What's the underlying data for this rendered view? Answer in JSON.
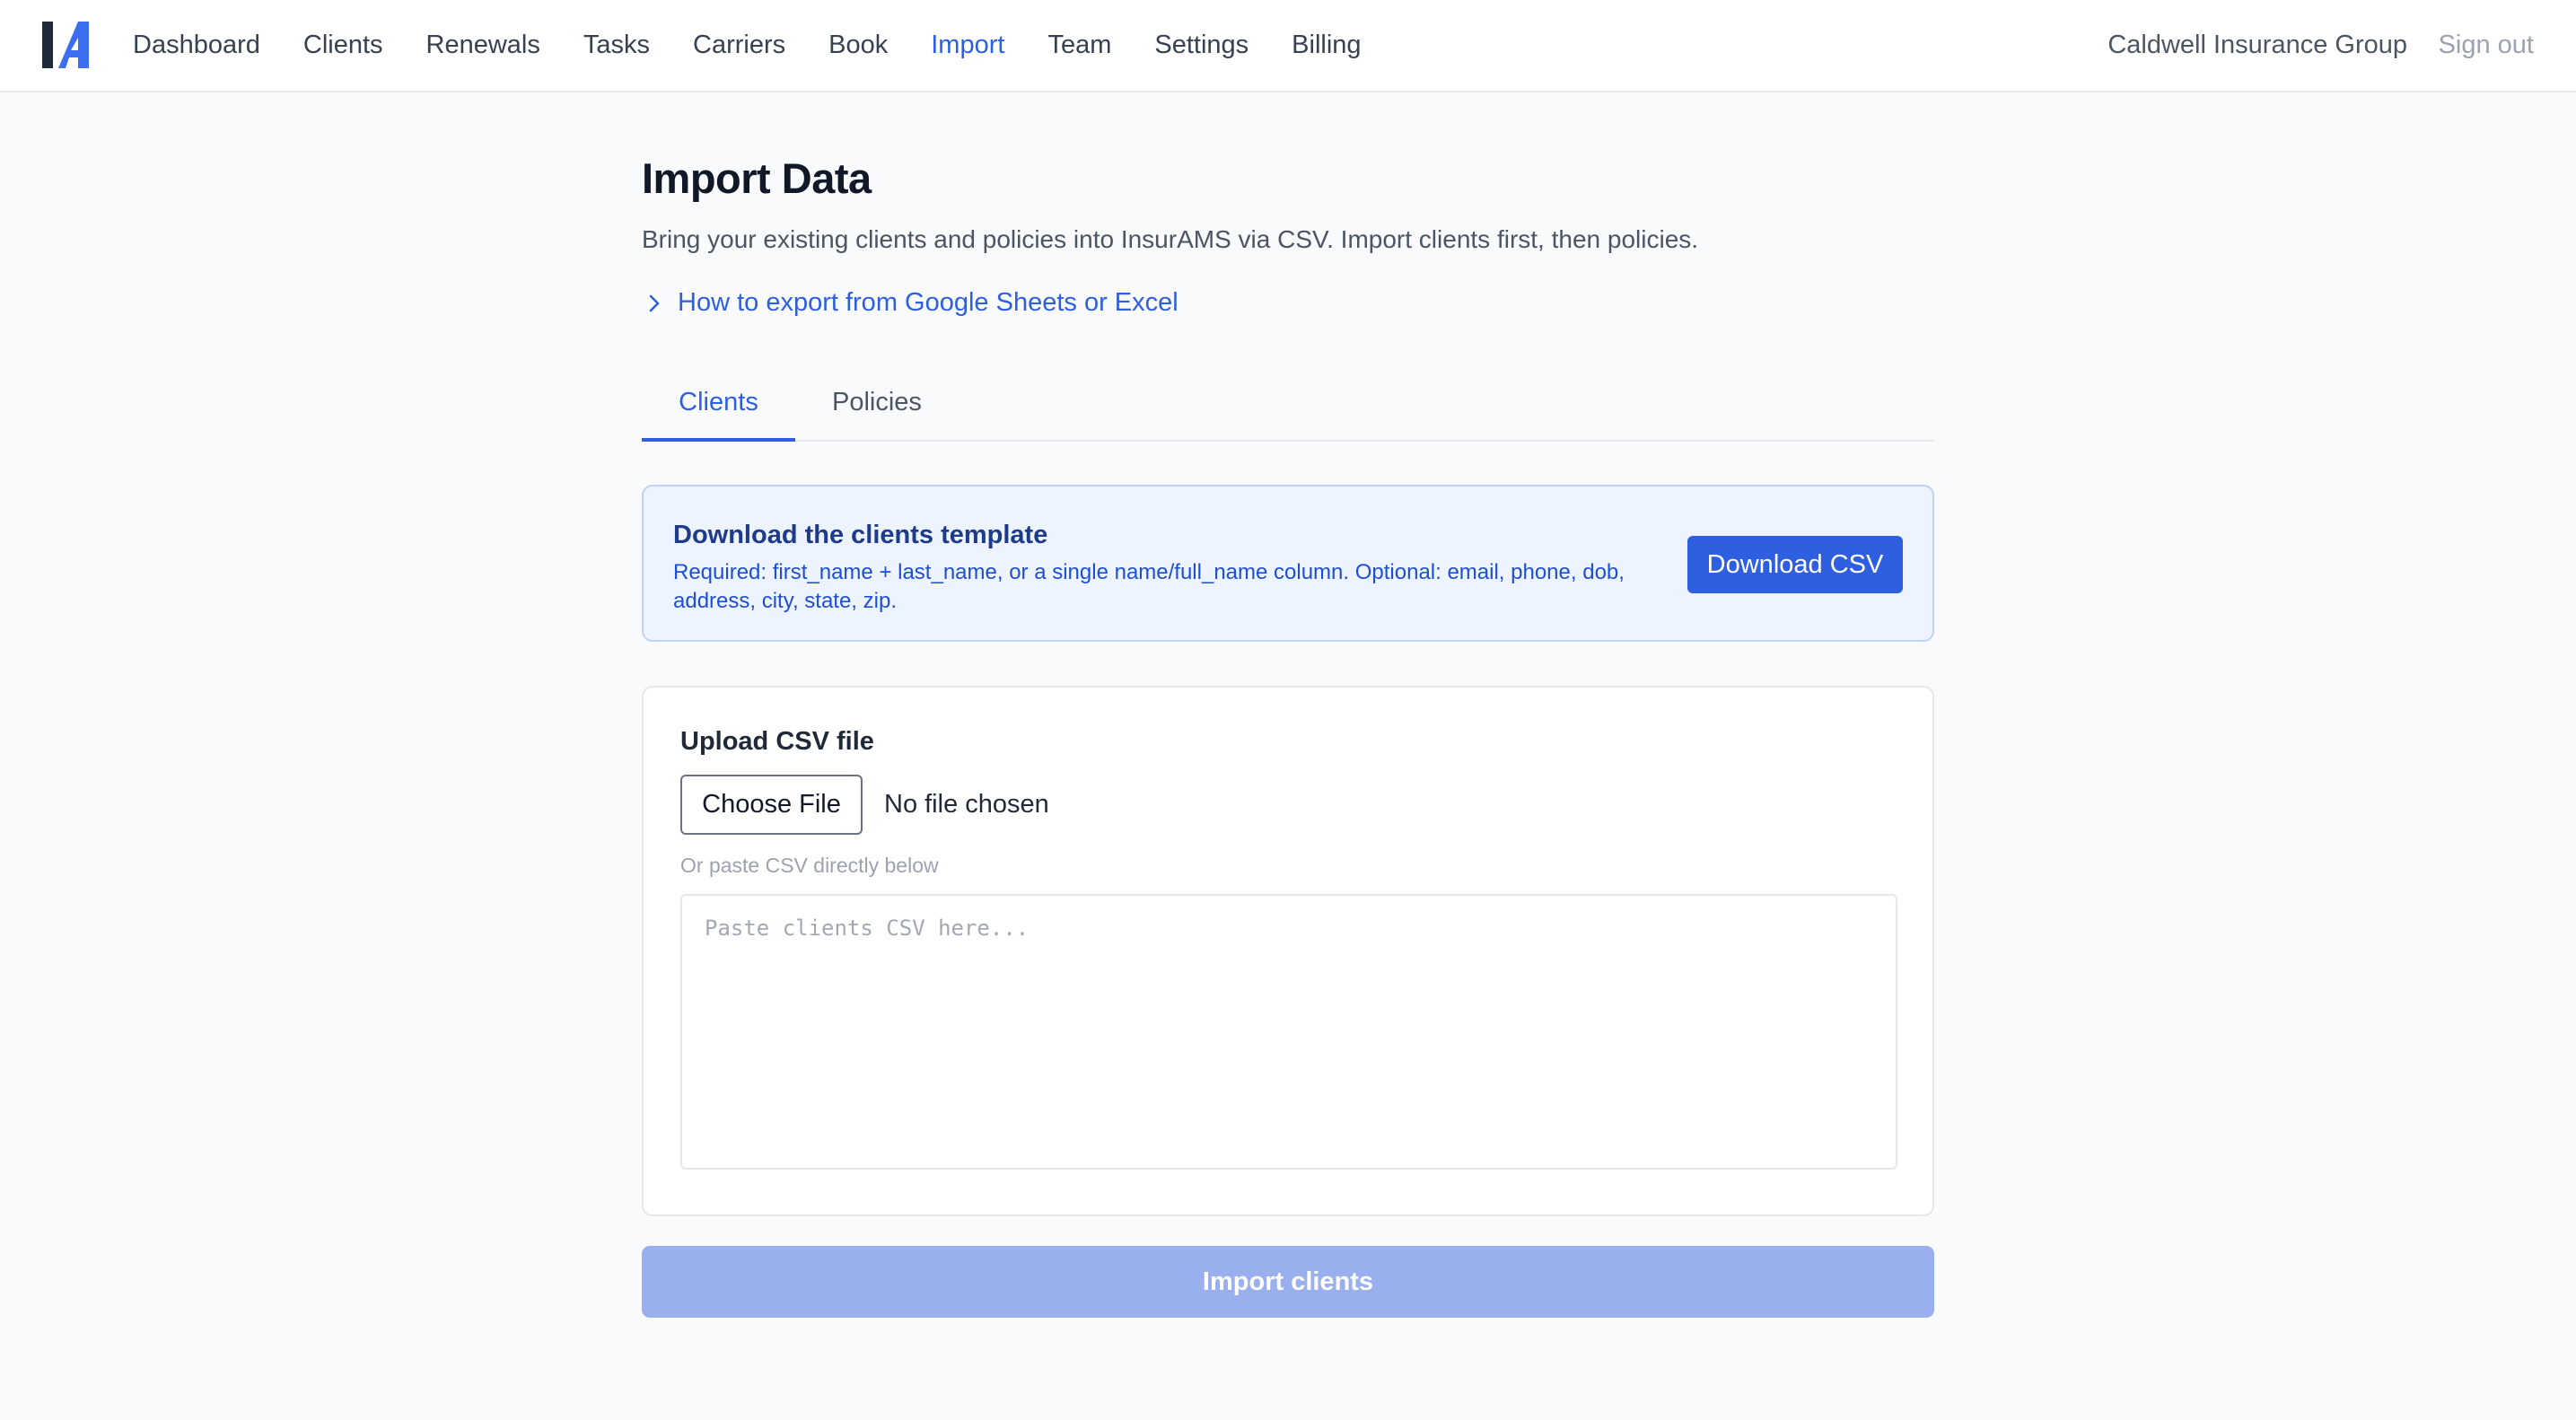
{
  "nav": {
    "logo_icon": "insurams-logo-icon",
    "links": [
      "Dashboard",
      "Clients",
      "Renewals",
      "Tasks",
      "Carriers",
      "Book",
      "Import",
      "Team",
      "Settings",
      "Billing"
    ],
    "active": "Import",
    "org_name": "Caldwell Insurance Group",
    "sign_out": "Sign out"
  },
  "page": {
    "title": "Import Data",
    "subtitle": "Bring your existing clients and policies into InsurAMS via CSV. Import clients first, then policies.",
    "help_link": "How to export from Google Sheets or Excel",
    "help_icon": "chevron-right-icon"
  },
  "tabs": {
    "clients": "Clients",
    "policies": "Policies",
    "active": "Clients"
  },
  "template": {
    "title": "Download the clients template",
    "description": "Required: first_name + last_name, or a single name/full_name column. Optional: email, phone, dob, address, city, state, zip.",
    "button": "Download CSV"
  },
  "upload": {
    "label": "Upload CSV file",
    "choose_button": "Choose File",
    "no_file": "No file chosen",
    "paste_hint": "Or paste CSV directly below",
    "textarea_value": "",
    "textarea_placeholder": "Paste clients CSV here..."
  },
  "import_button": "Import clients",
  "colors": {
    "accent": "#2d5fe0",
    "accent_disabled": "#9ab0ee",
    "info_bg": "#eef4ff",
    "info_border": "#bfd3f7",
    "page_bg": "#f8fafc"
  }
}
